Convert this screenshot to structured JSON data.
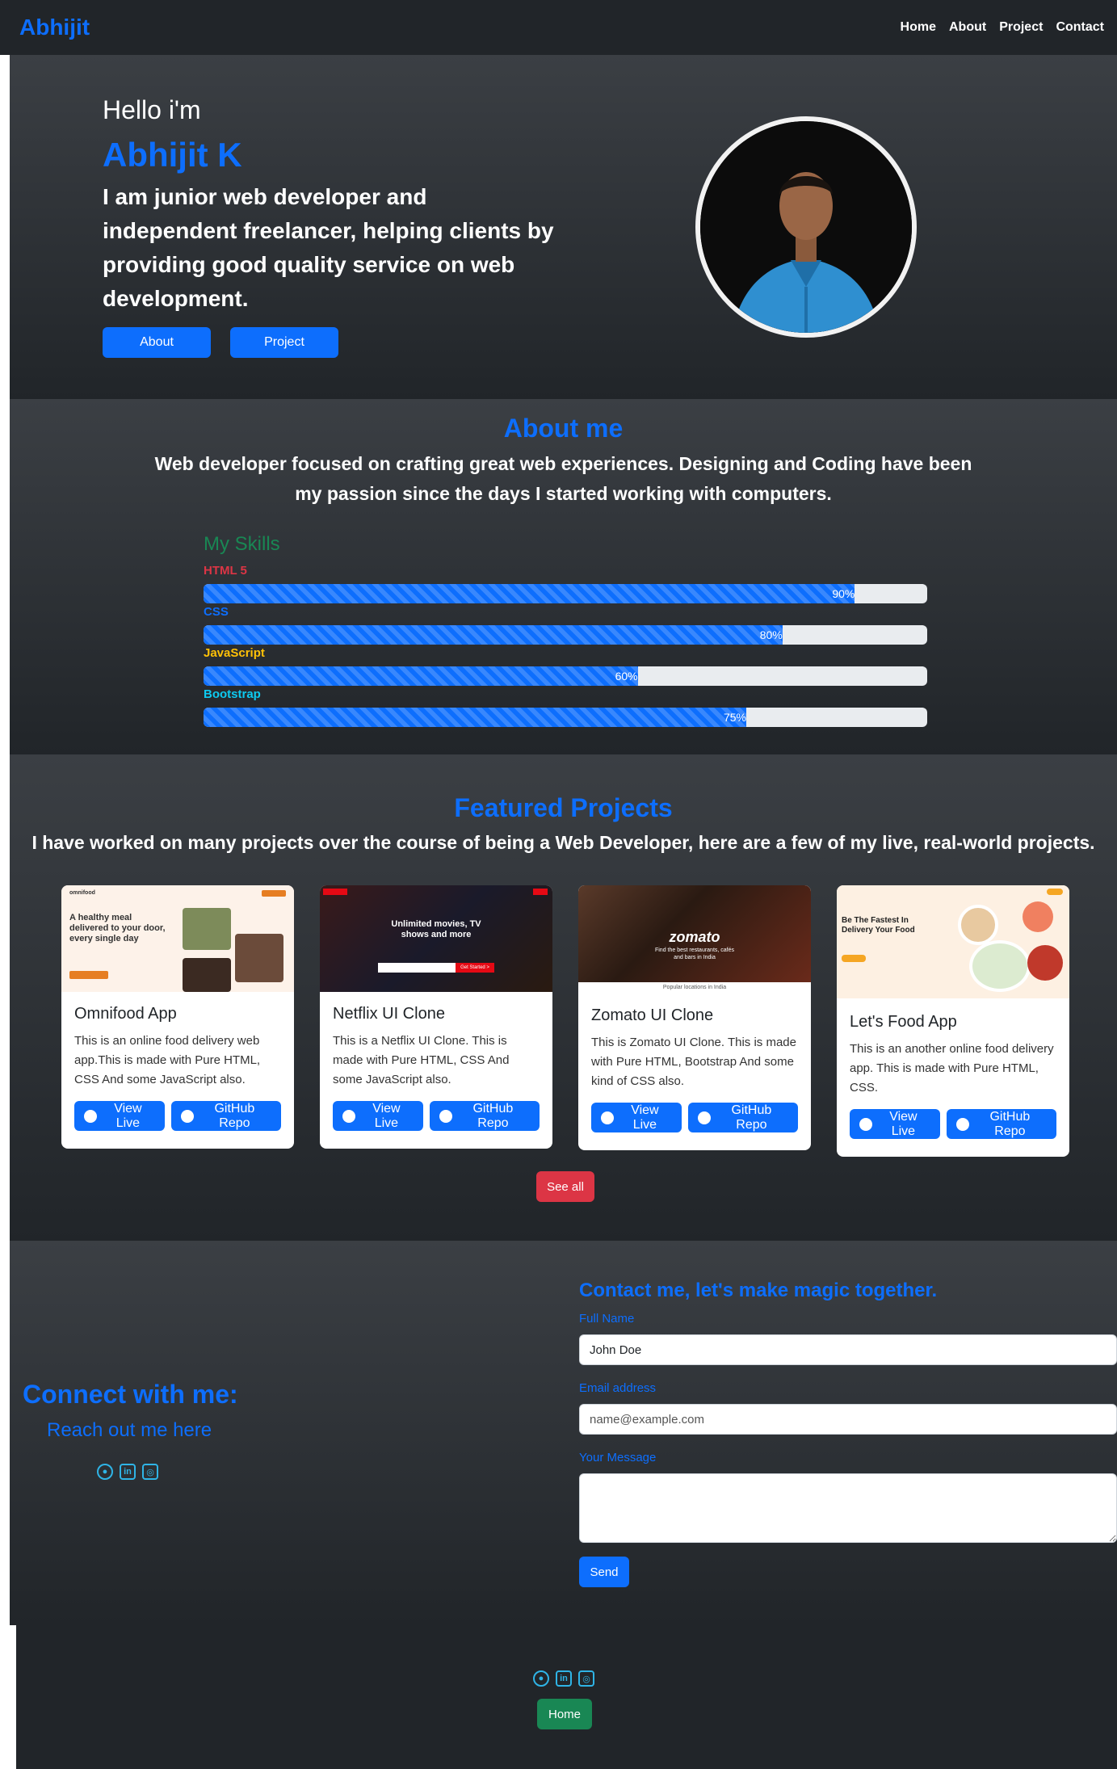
{
  "nav": {
    "brand": "Abhijit",
    "links": [
      "Home",
      "About",
      "Project",
      "Contact"
    ]
  },
  "hero": {
    "greeting": "Hello i'm",
    "name": "Abhijit K",
    "description": "I am junior web developer and independent freelancer, helping clients by providing good quality service on web development.",
    "buttons": {
      "about": "About",
      "project": "Project"
    }
  },
  "about": {
    "title": "About me",
    "text": "Web developer focused on crafting great web experiences. Designing and Coding have been my passion since the days I started working with computers.",
    "skills_title": "My Skills",
    "skills": [
      {
        "name": "HTML 5",
        "label": "90%",
        "percent": 90,
        "color": "#dc3545"
      },
      {
        "name": "CSS",
        "label": "80%",
        "percent": 80,
        "color": "#0d6efd"
      },
      {
        "name": "JavaScript",
        "label": "60%",
        "percent": 60,
        "color": "#ffc107"
      },
      {
        "name": "Bootstrap",
        "label": "75%",
        "percent": 75,
        "color": "#0dcaf0"
      }
    ]
  },
  "projects": {
    "title": "Featured Projects",
    "subtitle": "I have worked on many projects over the course of being a Web Developer, here are a few of my live, real-world projects.",
    "cards": [
      {
        "title": "Omnifood App",
        "text": "This is an online food delivery web app.This is made with Pure HTML, CSS And some JavaScript also.",
        "live": "View Live",
        "repo": "GitHub Repo",
        "preview": {
          "headline": "A healthy meal delivered to your door, every single day",
          "logo": "omnifood"
        }
      },
      {
        "title": "Netflix UI Clone",
        "text": "This is a Netflix UI Clone. This is made with Pure HTML, CSS And some JavaScript also.",
        "live": "View Live",
        "repo": "GitHub Repo",
        "preview": {
          "headline": "Unlimited movies, TV shows and more",
          "cta": "Get Started >"
        }
      },
      {
        "title": "Zomato UI Clone",
        "text": "This is Zomato UI Clone. This is made with Pure HTML, Bootstrap And some kind of CSS also.",
        "live": "View Live",
        "repo": "GitHub Repo",
        "preview": {
          "logo": "zomato",
          "headline": "Find the best restaurants, cafés and bars in India",
          "footer": "Popular locations in India"
        }
      },
      {
        "title": "Let's Food App",
        "text": "This is an another online food delivery app. This is made with Pure HTML, CSS.",
        "live": "View Live",
        "repo": "GitHub Repo",
        "preview": {
          "headline": "Be The Fastest In Delivery Your Food"
        }
      }
    ],
    "see_all": "See all"
  },
  "contact": {
    "connect_title": "Connect with me:",
    "connect_sub": "Reach out me here",
    "form_title": "Contact me, let's make magic together.",
    "name_label": "Full Name",
    "name_value": "John Doe",
    "email_label": "Email address",
    "email_placeholder": "name@example.com",
    "message_label": "Your Message",
    "message_value": "",
    "send": "Send"
  },
  "social_icons": [
    "github-icon",
    "linkedin-icon",
    "instagram-icon"
  ],
  "footer": {
    "home": "Home"
  },
  "colors": {
    "primary": "#0d6efd",
    "dark": "#212529",
    "success": "#198754",
    "danger": "#dc3545",
    "warning": "#ffc107",
    "info": "#0dcaf0"
  }
}
